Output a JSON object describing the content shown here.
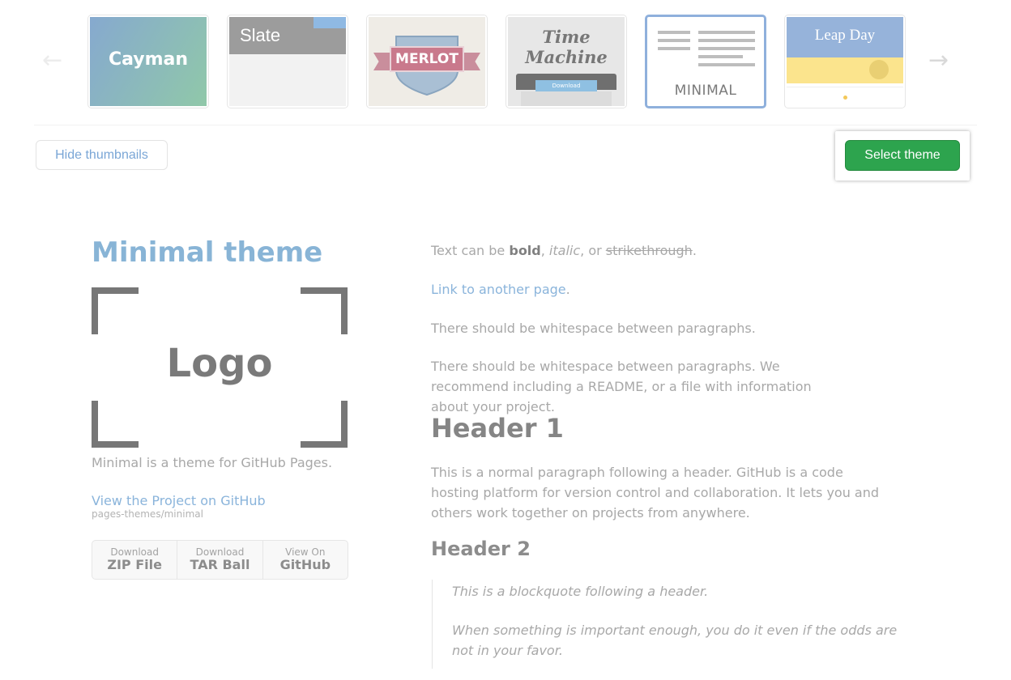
{
  "carousel": {
    "prev_arrow": "←",
    "next_arrow": "→",
    "themes": [
      {
        "id": "cayman",
        "label": "Cayman"
      },
      {
        "id": "slate",
        "label": "Slate"
      },
      {
        "id": "merlot",
        "label": "MERLOT"
      },
      {
        "id": "time-machine",
        "label": "Time Machine",
        "label_line1": "Time",
        "label_line2": "Machine",
        "button_label": "Download"
      },
      {
        "id": "minimal",
        "label": "MINIMAL",
        "selected": true
      },
      {
        "id": "leap-day",
        "label": "Leap Day"
      }
    ]
  },
  "actions": {
    "hide_thumbnails": "Hide thumbnails",
    "select_theme": "Select theme",
    "select_theme_color": "#2da44e"
  },
  "preview": {
    "title": "Minimal theme",
    "logo_text": "Logo",
    "description": "Minimal is a theme for GitHub Pages.",
    "project_link": "View the Project on GitHub",
    "repo": "pages-themes/minimal",
    "downloads": [
      {
        "small": "Download",
        "big": "ZIP File"
      },
      {
        "small": "Download",
        "big": "TAR Ball"
      },
      {
        "small": "View On",
        "big": "GitHub"
      }
    ],
    "content": {
      "p1_prefix": "Text can be ",
      "p1_bold": "bold",
      "p1_sep1": ", ",
      "p1_italic": "italic",
      "p1_sep2": ", or ",
      "p1_strike": "strikethrough",
      "p1_end": ".",
      "link": "Link to another page",
      "link_end": ".",
      "p2": "There should be whitespace between paragraphs.",
      "p3": "There should be whitespace between paragraphs. We recommend including a README, or a file with information about your project.",
      "h1": "Header 1",
      "p4": "This is a normal paragraph following a header. GitHub is a code hosting platform for version control and collaboration. It lets you and others work together on projects from anywhere.",
      "h2": "Header 2",
      "quote1": "This is a blockquote following a header.",
      "quote2": "When something is important enough, you do it even if the odds are not in your favor."
    }
  }
}
